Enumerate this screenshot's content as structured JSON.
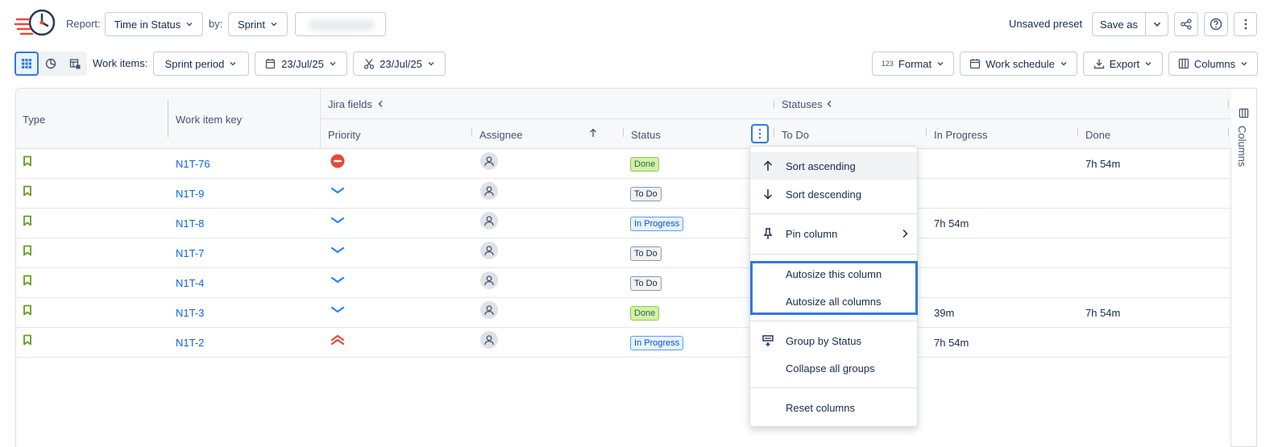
{
  "toolbar1": {
    "report_label": "Report:",
    "report_value": "Time in Status",
    "by_label": "by:",
    "by_value": "Sprint",
    "preset_status": "Unsaved preset",
    "save_as": "Save as"
  },
  "toolbar2": {
    "work_items_label": "Work items:",
    "period_value": "Sprint period",
    "start_date": "23/Jul/25",
    "end_date": "23/Jul/25",
    "format_label": "Format",
    "format_icon_text": "123",
    "schedule_label": "Work schedule",
    "export_label": "Export",
    "columns_label": "Columns"
  },
  "grid": {
    "headers": {
      "type": "Type",
      "key": "Work item key",
      "jira_group": "Jira fields",
      "statuses_group": "Statuses",
      "priority": "Priority",
      "assignee": "Assignee",
      "status": "Status",
      "todo": "To Do",
      "in_progress": "In Progress",
      "done": "Done"
    },
    "rows": [
      {
        "key": "N1T-76",
        "priority": "highest",
        "status": "Done",
        "status_kind": "done",
        "in_progress": "",
        "done": "7h 54m"
      },
      {
        "key": "N1T-9",
        "priority": "low",
        "status": "To Do",
        "status_kind": "todo",
        "in_progress": "",
        "done": ""
      },
      {
        "key": "N1T-8",
        "priority": "low",
        "status": "In Progress",
        "status_kind": "prog",
        "in_progress": "7h 54m",
        "done": ""
      },
      {
        "key": "N1T-7",
        "priority": "low",
        "status": "To Do",
        "status_kind": "todo",
        "in_progress": "",
        "done": ""
      },
      {
        "key": "N1T-4",
        "priority": "low",
        "status": "To Do",
        "status_kind": "todo",
        "in_progress": "",
        "done": ""
      },
      {
        "key": "N1T-3",
        "priority": "low",
        "status": "Done",
        "status_kind": "done",
        "in_progress": "39m",
        "done": "7h 54m"
      },
      {
        "key": "N1T-2",
        "priority": "high",
        "status": "In Progress",
        "status_kind": "prog",
        "in_progress": "7h 54m",
        "done": ""
      }
    ]
  },
  "side_panel": {
    "label": "Columns"
  },
  "menu": {
    "sort_asc": "Sort ascending",
    "sort_desc": "Sort descending",
    "pin": "Pin column",
    "autosize_this": "Autosize this column",
    "autosize_all": "Autosize all columns",
    "group_by": "Group by Status",
    "collapse_groups": "Collapse all groups",
    "reset": "Reset columns"
  },
  "colors": {
    "accent": "#2f7bd8",
    "story_green": "#6a9a23",
    "link": "#0c66e4"
  }
}
